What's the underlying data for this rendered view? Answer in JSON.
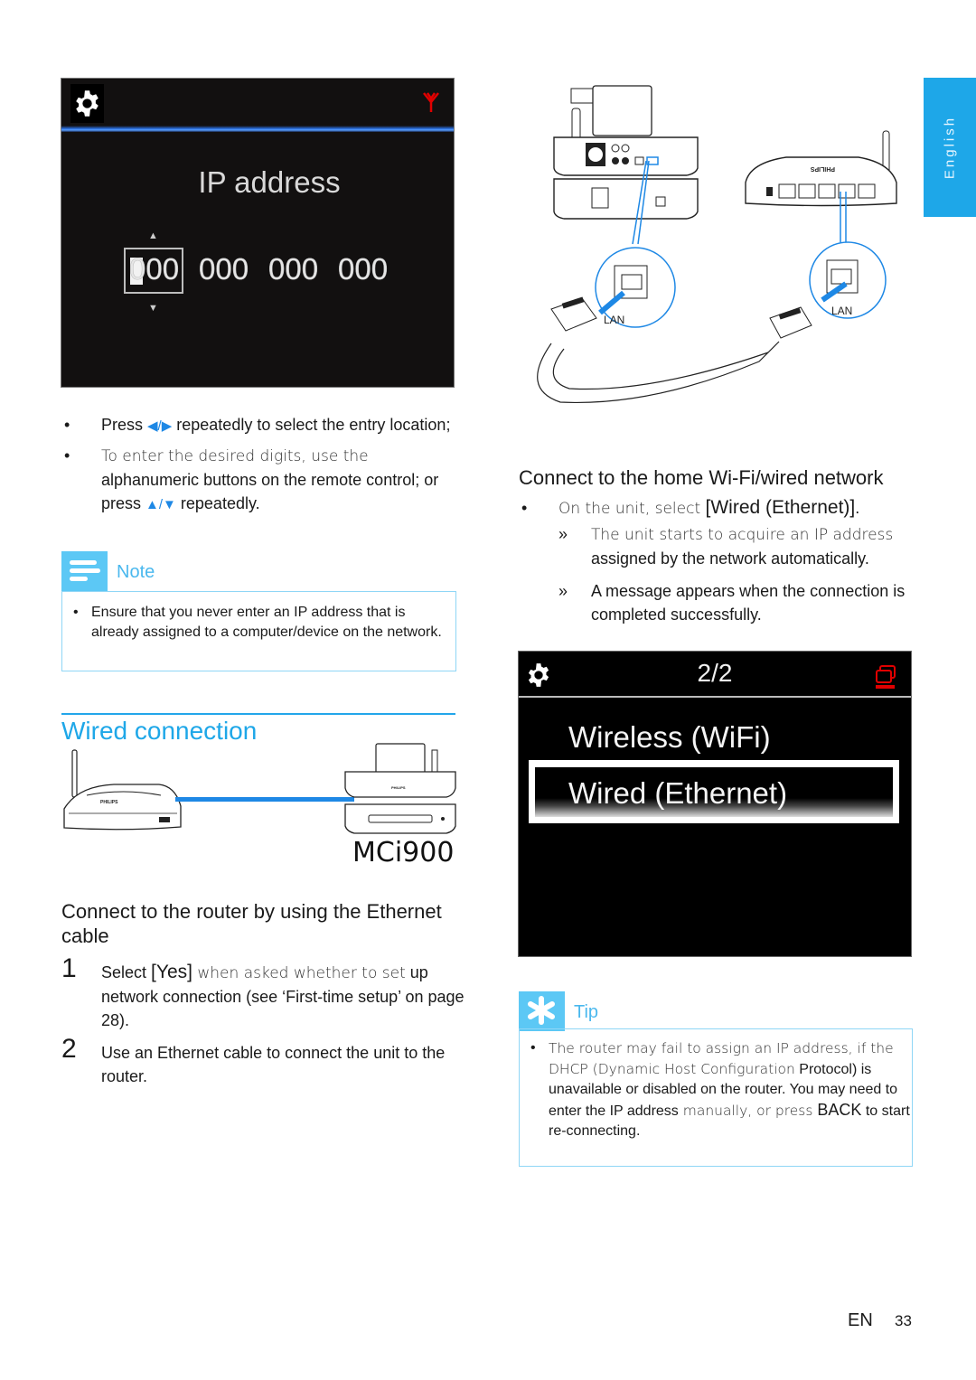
{
  "language_tab": "English",
  "ip_screen": {
    "title": "IP address",
    "octets": [
      "000",
      "000",
      "000",
      "000"
    ],
    "up_arrow": "▲",
    "down_arrow": "▼",
    "icons": [
      "gear-icon",
      "antenna-icon"
    ],
    "colors": {
      "background": "#121010",
      "accent_line": "#2b6fe0",
      "antenna": "#e00000"
    }
  },
  "left_bullets": [
    {
      "pre": "Press ",
      "arrows": "◀/▶",
      "post": " repeatedly to select the entry location;"
    },
    {
      "light": "To enter the desired digits, use the",
      "rest": " alphanumeric buttons on the remote control; or press ",
      "arrows": "▲/▼",
      "post": " repeatedly."
    }
  ],
  "note": {
    "label": "Note",
    "items": [
      "Ensure that you never enter an IP address that is already assigned to a computer/device on the network."
    ]
  },
  "section": {
    "title": "Wired connection",
    "device_label": "MCi900"
  },
  "router_subsection": {
    "heading": "Connect to the router by using the Ethernet cable",
    "steps": [
      {
        "num": "1",
        "pre": "Select ",
        "bracket": "[Yes]",
        "light": " when asked whether to set",
        "rest": " up network connection (see ‘First-time setup’ on page 28)."
      },
      {
        "num": "2",
        "text": "Use an Ethernet cable to connect the unit to the router."
      }
    ]
  },
  "diagram": {
    "lan_label_left": "LAN",
    "lan_label_right": "LAN"
  },
  "home_network": {
    "heading": "Connect to the home Wi-Fi/wired network",
    "bullet": {
      "light": "On the unit, select ",
      "bracket": "[Wired (Ethernet)]",
      "end": "."
    },
    "results": [
      {
        "mark": "»",
        "light": "The unit starts to acquire an IP address",
        "rest": " assigned by the network automatically."
      },
      {
        "mark": "»",
        "text": "A message appears when the connection is completed successfully."
      }
    ]
  },
  "menu_screen": {
    "page": "2/2",
    "items": [
      {
        "label": "Wireless (WiFi)",
        "selected": false
      },
      {
        "label": "Wired (Ethernet)",
        "selected": true
      }
    ],
    "icons": [
      "gear-icon",
      "pc-network-icon"
    ],
    "colors": {
      "pc_icon": "#e00000"
    }
  },
  "tip": {
    "label": "Tip",
    "items": [
      {
        "light": "The router may fail to assign an IP address, if the DHCP (Dynamic Host Configuration",
        "rest": " Protocol) is unavailable or disabled on the router. You may need to enter the IP address",
        "light2": " manually, or press ",
        "key": "BACK",
        "end": " to start re-connecting."
      }
    ]
  },
  "footer": {
    "lang": "EN",
    "page": "33"
  },
  "colors": {
    "accent": "#1ea7e8",
    "callout_icon_bg": "#5cc8f5",
    "callout_border": "#8fd6f6"
  }
}
